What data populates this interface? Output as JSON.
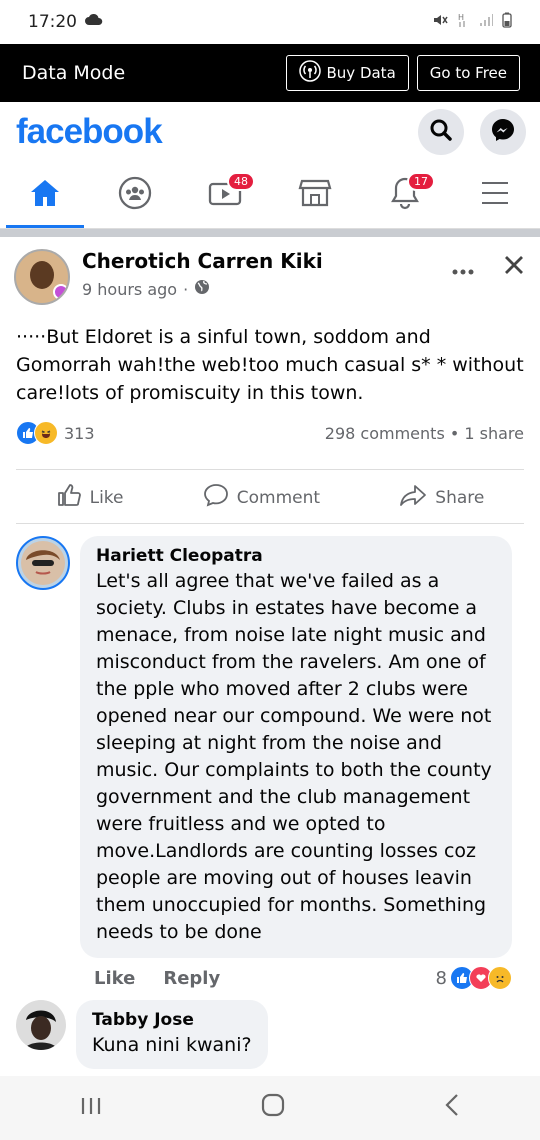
{
  "status_bar": {
    "time": "17:20"
  },
  "data_mode": {
    "title": "Data Mode",
    "buy_data": "Buy Data",
    "go_free": "Go to Free"
  },
  "header": {
    "logo": "facebook"
  },
  "tabs": {
    "videos_badge": "48",
    "notifications_badge": "17"
  },
  "post": {
    "author": "Cherotich Carren Kiki",
    "time": "9 hours ago",
    "text": "·····But Eldoret is a sinful town, soddom and Gomorrah wah!the web!too much casual s* * without care!lots of promiscuity in this town.",
    "reaction_count": "313",
    "comments_shares": "298 comments • 1 share",
    "like_label": "Like",
    "comment_label": "Comment",
    "share_label": "Share"
  },
  "comments": [
    {
      "name": "Hariett Cleopatra",
      "text": "Let's all agree that we've failed as a society. Clubs in estates have become a menace, from noise late night music and misconduct from the ravelers. Am one of the pple who moved after 2 clubs were opened near our compound. We were not sleeping at night from the noise and music. Our complaints to both the county government and the club management were fruitless and we opted to move.Landlords are counting losses coz people are moving out of houses leavin them unoccupied for months. Something needs to be done",
      "like": "Like",
      "reply": "Reply",
      "reactions": "8"
    },
    {
      "name": "Tabby Jose",
      "text": "Kuna nini kwani?"
    }
  ],
  "colors": {
    "brand": "#1877f2",
    "badge": "#e41e3f"
  }
}
